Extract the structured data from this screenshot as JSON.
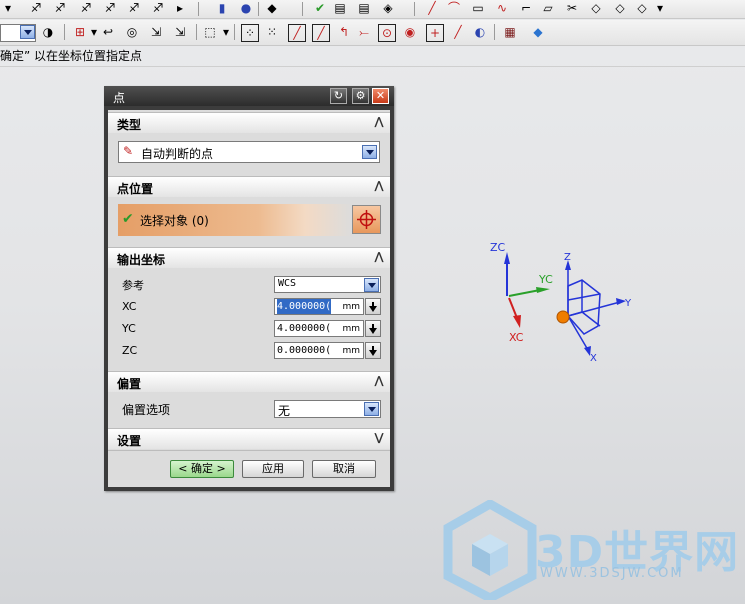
{
  "prompt_text": "确定” 以在坐标位置指定点",
  "dialog": {
    "title": "点",
    "sections": {
      "type": {
        "label": "类型",
        "select_value": "自动判断的点"
      },
      "point_location": {
        "label": "点位置",
        "select_object": "选择对象 (0)"
      },
      "output_coords": {
        "label": "输出坐标",
        "reference_label": "参考",
        "reference_value": "WCS",
        "xc_label": "XC",
        "xc_value": "4.000000(",
        "xc_unit": "mm",
        "yc_label": "YC",
        "yc_value": "4.000000(",
        "yc_unit": "mm",
        "zc_label": "ZC",
        "zc_value": "0.000000(",
        "zc_unit": "mm"
      },
      "offset": {
        "label": "偏置",
        "option_label": "偏置选项",
        "option_value": "无"
      },
      "settings": {
        "label": "设置"
      }
    },
    "buttons": {
      "ok": "< 确定 >",
      "apply": "应用",
      "cancel": "取消"
    }
  },
  "axes": {
    "abs": {
      "zc": "ZC",
      "yc": "YC",
      "xc": "XC"
    },
    "wcs": {
      "z": "Z",
      "y": "Y",
      "x": "X"
    }
  },
  "watermark": {
    "text": "3D世界网",
    "url": "WWW.3DSJW.COM"
  },
  "colors": {
    "accent_orange": "#e9a36c",
    "axis_blue": "#2434d8",
    "axis_red": "#d02020",
    "axis_green": "#2aa02a",
    "point_orange": "#f07d00"
  }
}
